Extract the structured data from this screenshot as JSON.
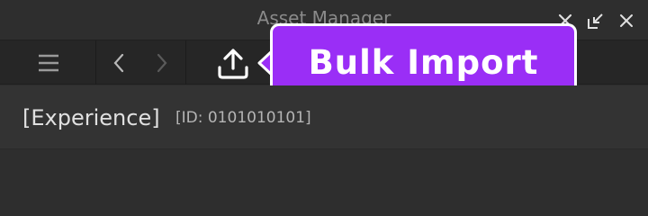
{
  "window": {
    "title": "Asset Manager",
    "controls": [
      "close-icon",
      "dock-icon",
      "close-icon"
    ]
  },
  "toolbar": {
    "buttons": [
      "menu-icon",
      "back-arrow-icon",
      "forward-arrow-icon",
      "upload-icon"
    ]
  },
  "callout": {
    "text": "Bulk Import",
    "color": "#9a2ef6"
  },
  "experience": {
    "name": "[Experience]",
    "id": "[ID: 0101010101]"
  }
}
